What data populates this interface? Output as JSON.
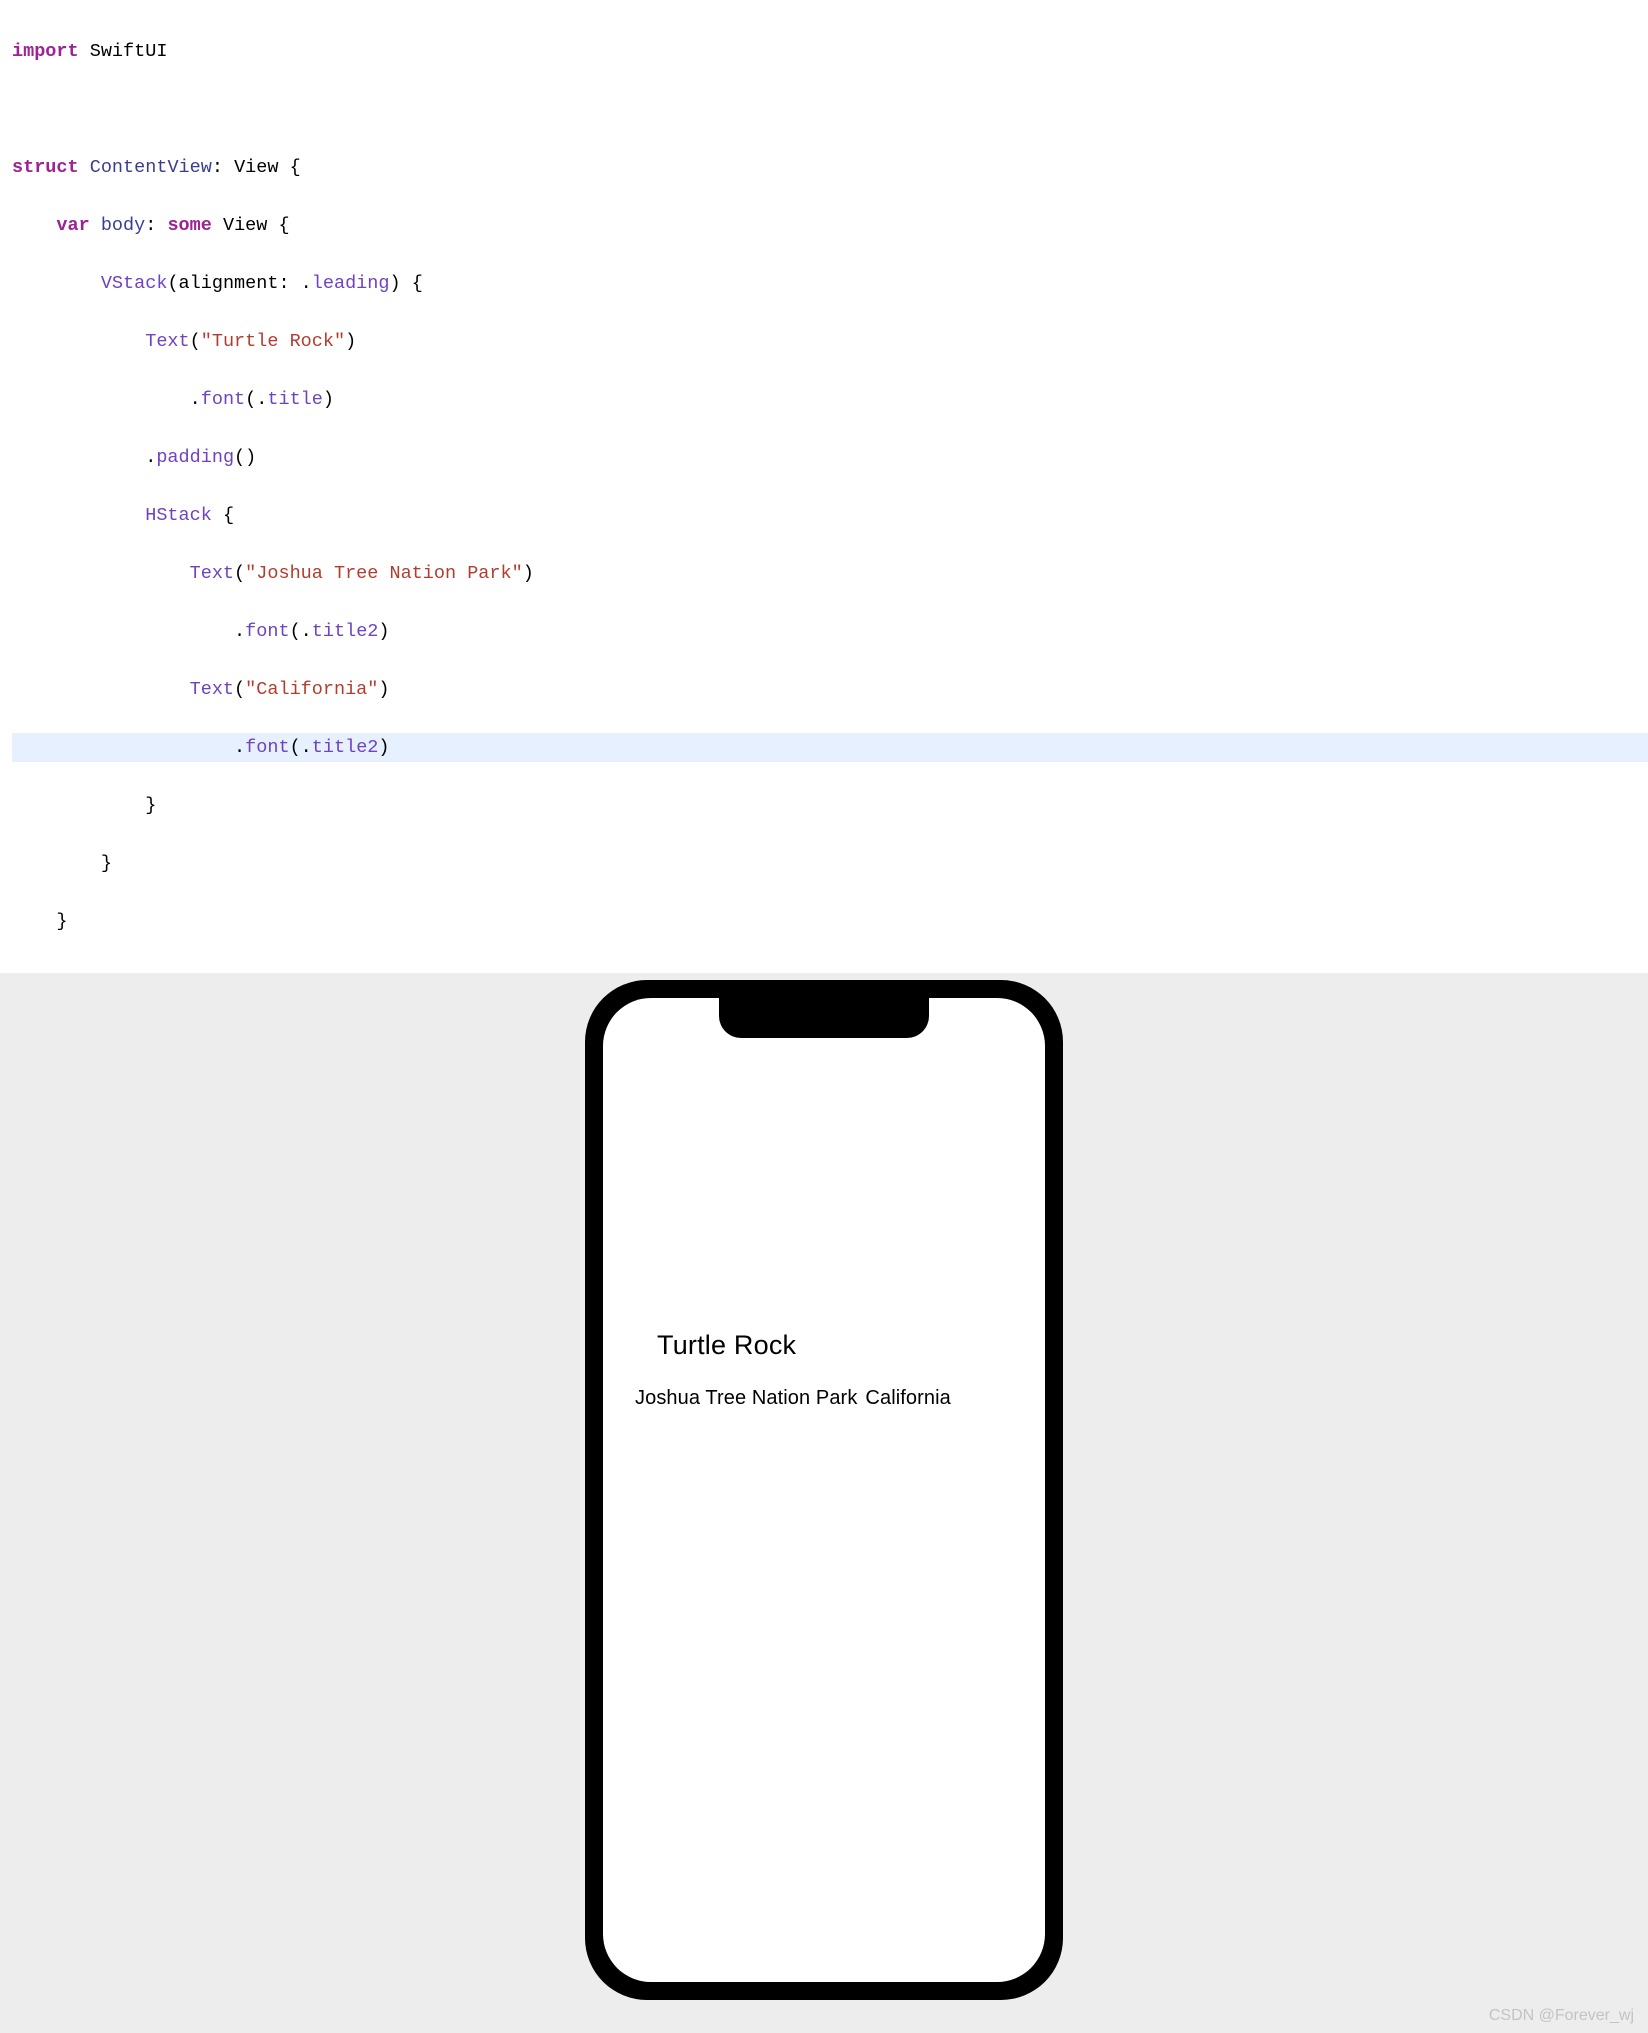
{
  "code": {
    "l1_import": "import",
    "l1_module": " SwiftUI",
    "l3_struct": "struct",
    "l3_name": " ContentView",
    "l3_colon_view": ": View {",
    "l4_var": "    var",
    "l4_body": " body",
    "l4_colon": ": ",
    "l4_some": "some",
    "l4_view": " View {",
    "l5_vstack": "        VStack",
    "l5_args": "(alignment: .",
    "l5_leading": "leading",
    "l5_close": ") {",
    "l6_text": "            Text",
    "l6_paren_open": "(",
    "l6_string": "\"Turtle Rock\"",
    "l6_paren_close": ")",
    "l7_dot": "                .",
    "l7_font": "font",
    "l7_paren_open": "(.",
    "l7_title": "title",
    "l7_paren_close": ")",
    "l8_dot": "            .",
    "l8_padding": "padding",
    "l8_parens": "()",
    "l9_hstack": "            HStack",
    "l9_brace": " {",
    "l10_text": "                Text",
    "l10_paren_open": "(",
    "l10_string": "\"Joshua Tree Nation Park\"",
    "l10_paren_close": ")",
    "l11_dot": "                    .",
    "l11_font": "font",
    "l11_paren_open": "(.",
    "l11_title2": "title2",
    "l11_paren_close": ")",
    "l12_text": "                Text",
    "l12_paren_open": "(",
    "l12_string": "\"California\"",
    "l12_paren_close": ")",
    "l13_dot": "                    .",
    "l13_font": "font",
    "l13_paren_open": "(.",
    "l13_title2": "title2",
    "l13_paren_close": ")",
    "l14": "            }",
    "l15": "        }",
    "l16": "    }"
  },
  "preview": {
    "title": "Turtle Rock",
    "subtitle1": "Joshua Tree Nation Park",
    "subtitle2": "California"
  },
  "watermark": "CSDN @Forever_wj"
}
